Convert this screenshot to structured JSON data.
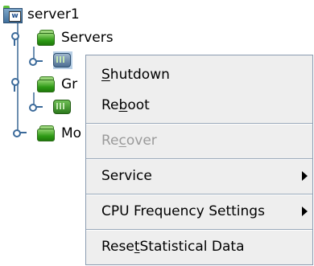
{
  "tree": {
    "root": {
      "label": "server1",
      "icon": "server-icon",
      "tag_letter": "w"
    },
    "servers": {
      "label": "Servers",
      "icon": "folder-icon"
    },
    "server_child": {
      "icon": "server-node-icon"
    },
    "groups": {
      "label_visible": "Gr",
      "icon": "folder-icon"
    },
    "group_child": {
      "icon": "node-icon"
    },
    "monitors": {
      "label_visible": "Mo",
      "icon": "folder-icon"
    }
  },
  "context_menu": {
    "items": [
      {
        "pre": "",
        "mnemonic": "S",
        "post": "hutdown",
        "enabled": true,
        "submenu": false
      },
      {
        "pre": "Re",
        "mnemonic": "b",
        "post": "oot",
        "enabled": true,
        "submenu": false
      },
      {
        "pre": "Re",
        "mnemonic": "c",
        "post": "over",
        "enabled": false,
        "submenu": false
      },
      {
        "pre": "Service",
        "mnemonic": "",
        "post": "",
        "enabled": true,
        "submenu": true
      },
      {
        "pre": "CPU Frequency Settings",
        "mnemonic": "",
        "post": "",
        "enabled": true,
        "submenu": true
      },
      {
        "pre": "Rese",
        "mnemonic": "t",
        "post": " Statistical Data",
        "enabled": true,
        "submenu": false
      }
    ]
  },
  "colors": {
    "selection": "#b8cfe5",
    "menu_bg": "#eeeeee",
    "disabled_text": "#9a9a9a",
    "folder_green": "#2e9a15"
  }
}
